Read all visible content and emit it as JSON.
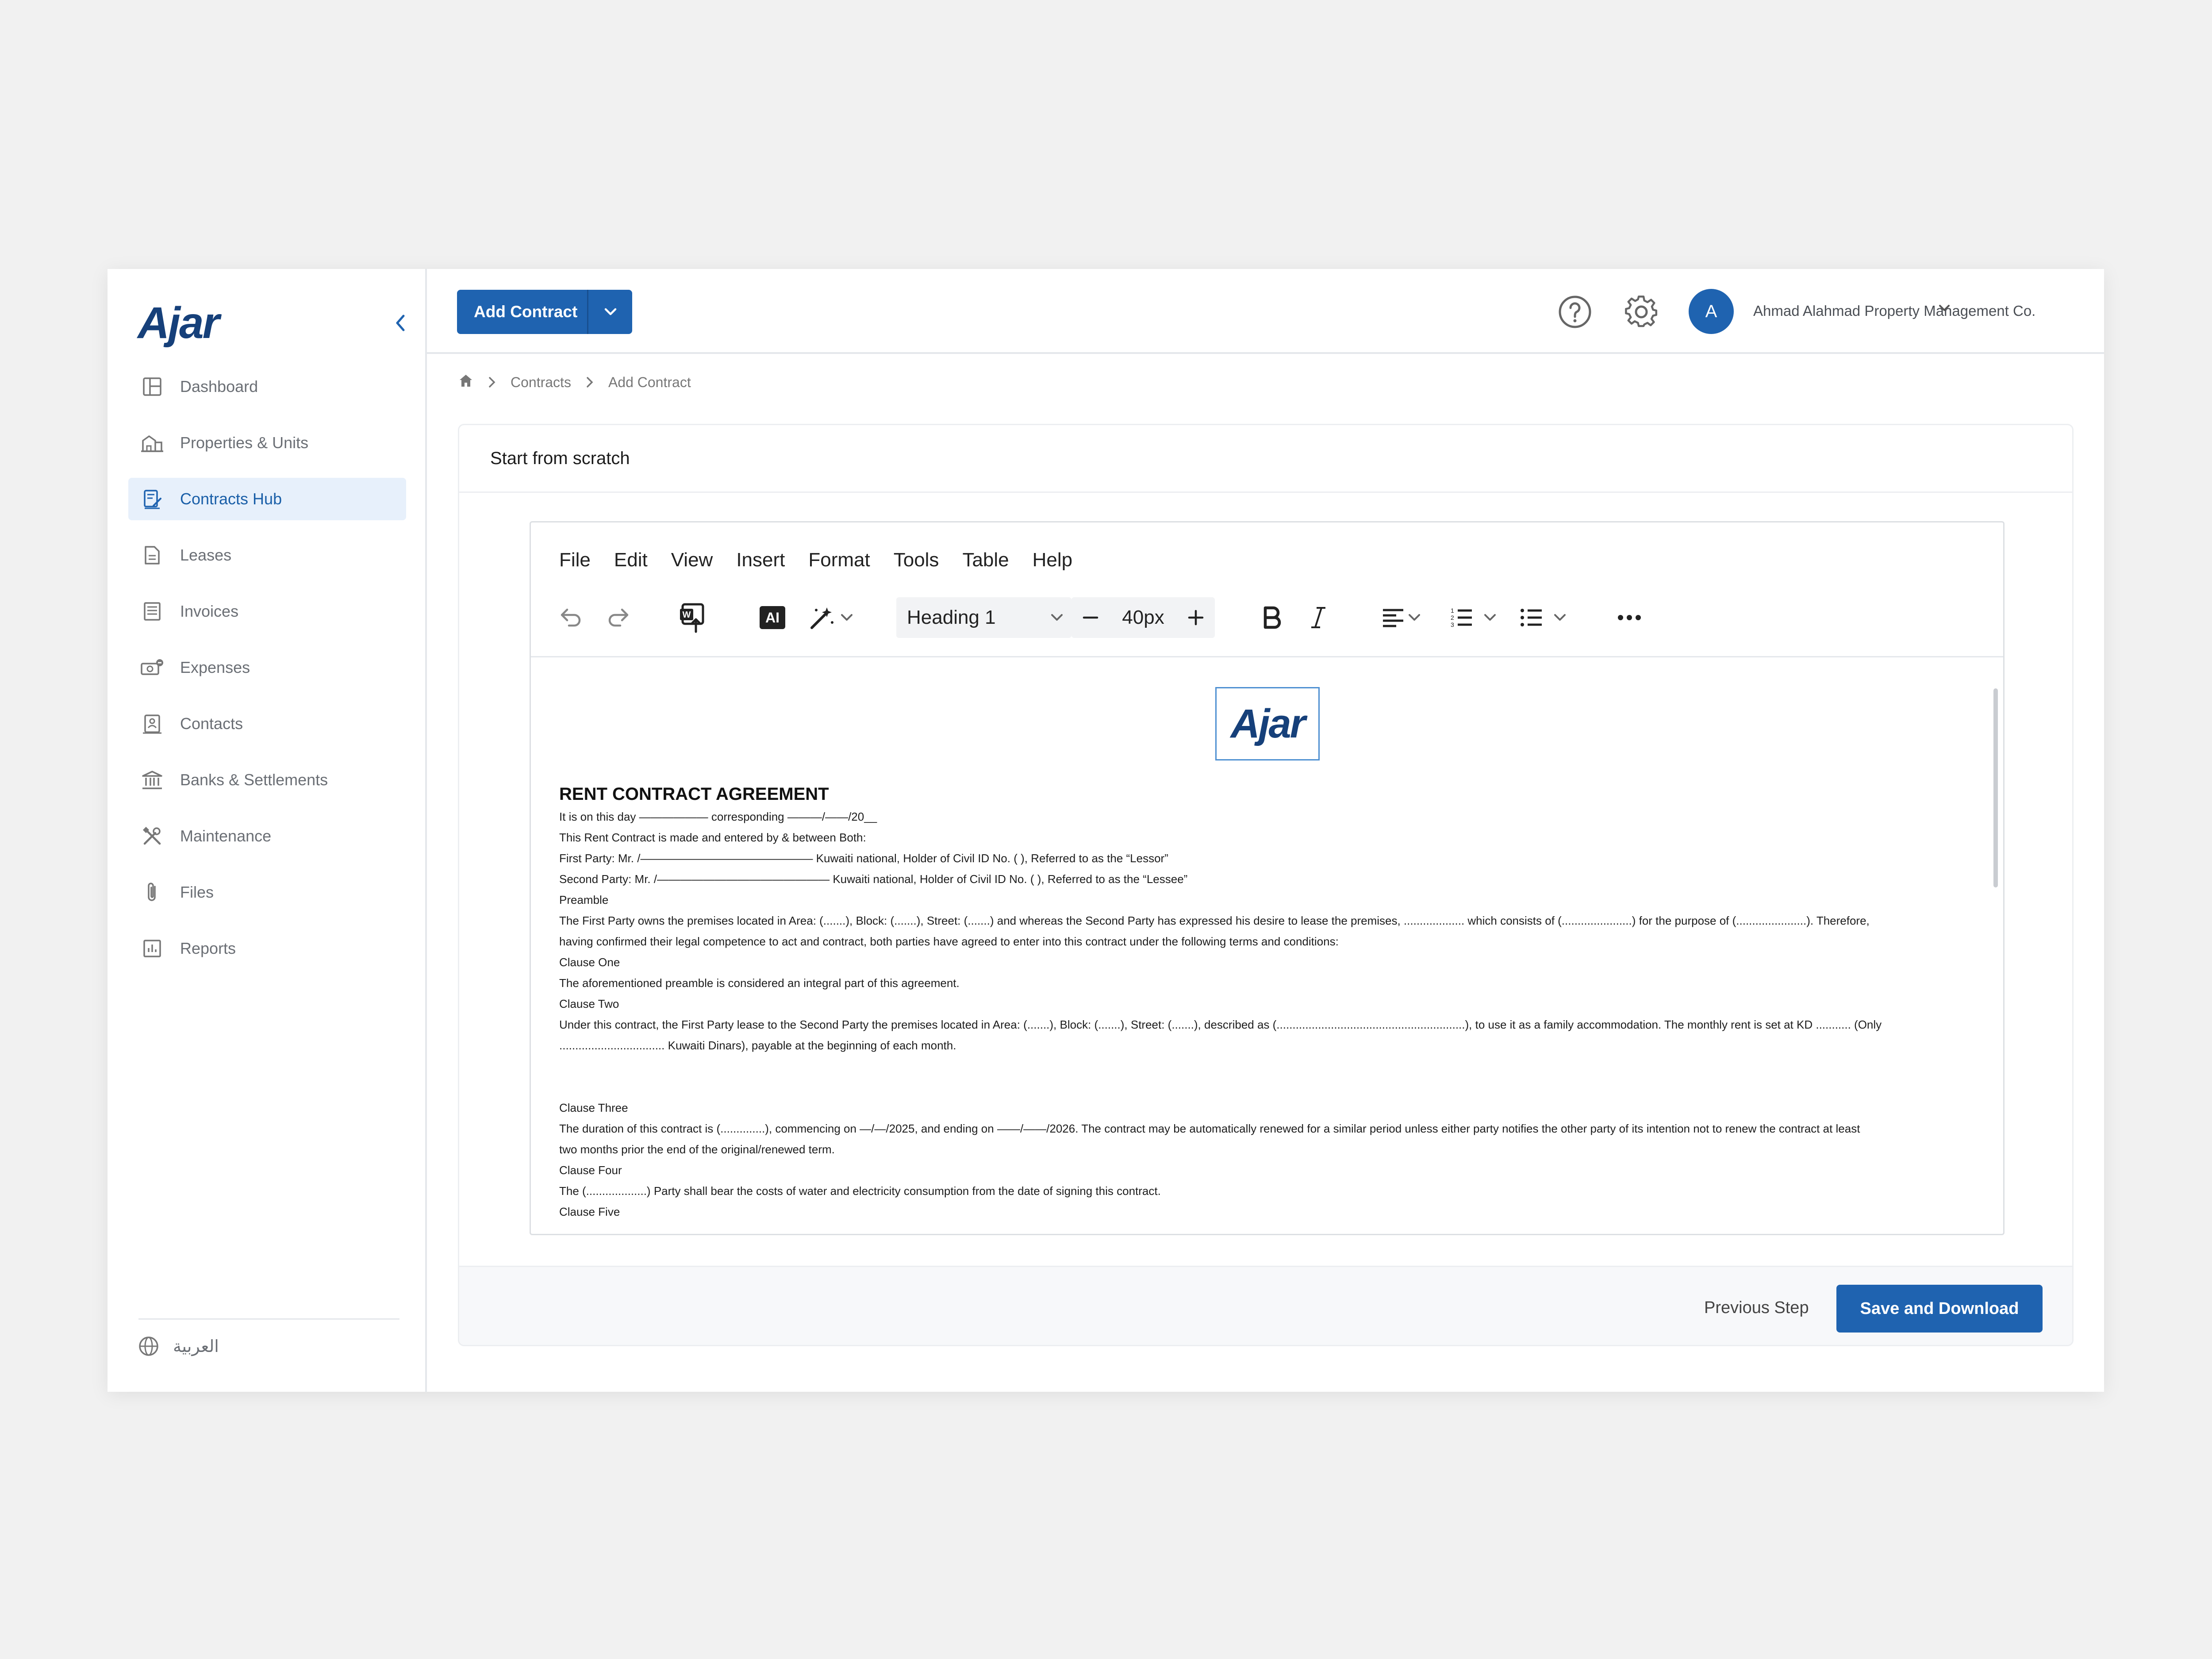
{
  "app": {
    "logo": "Ajar"
  },
  "sidebar": {
    "items": [
      {
        "label": "Dashboard",
        "icon": "layout-icon"
      },
      {
        "label": "Properties & Units",
        "icon": "building-icon"
      },
      {
        "label": "Contracts Hub",
        "icon": "contract-icon",
        "active": true
      },
      {
        "label": "Leases",
        "icon": "document-icon"
      },
      {
        "label": "Invoices",
        "icon": "invoice-icon"
      },
      {
        "label": "Expenses",
        "icon": "money-icon"
      },
      {
        "label": "Contacts",
        "icon": "contact-icon"
      },
      {
        "label": "Banks & Settlements",
        "icon": "bank-icon"
      },
      {
        "label": "Maintenance",
        "icon": "tools-icon"
      },
      {
        "label": "Files",
        "icon": "paperclip-icon"
      },
      {
        "label": "Reports",
        "icon": "chart-icon"
      }
    ],
    "language": "العربية"
  },
  "header": {
    "add_contract": "Add Contract",
    "avatar_initial": "A",
    "company": "Ahmad Alahmad Property Management Co."
  },
  "breadcrumb": {
    "level1": "Contracts",
    "level2": "Add Contract"
  },
  "card": {
    "title": "Start from scratch"
  },
  "editor": {
    "menus": [
      "File",
      "Edit",
      "View",
      "Insert",
      "Format",
      "Tools",
      "Table",
      "Help"
    ],
    "block_style": "Heading 1",
    "font_size": "40px",
    "ai_label": "AI"
  },
  "document": {
    "logo": "Ajar",
    "title": "RENT CONTRACT AGREEMENT",
    "lines": [
      "It is on this day —————— corresponding ———/——/20__",
      "This Rent Contract is made and entered by & between Both:",
      "First Party: Mr. /——————————————— Kuwaiti national, Holder of Civil ID No. ( ), Referred to as the “Lessor”",
      "Second Party: Mr. /——————————————— Kuwaiti national, Holder of Civil ID No. ( ), Referred to as the “Lessee”",
      "Preamble",
      "The First Party owns the premises located in Area: (.......), Block: (.......), Street: (.......) and whereas the Second Party has expressed his desire to lease the premises, ................... which consists of (......................) for the purpose of (......................). Therefore,",
      "having confirmed their legal competence to act and contract, both parties have agreed to enter into this contract under the following terms and conditions:",
      "Clause One",
      "The aforementioned preamble is considered an integral part of this agreement.",
      "Clause Two",
      "Under this contract, the First Party lease to the Second Party the premises located in Area: (.......), Block: (.......), Street: (.......), described as (...........................................................), to use it as a family accommodation. The monthly rent is set at KD ........... (Only",
      "................................. Kuwaiti Dinars), payable at the beginning of each month."
    ],
    "lines2": [
      "Clause Three",
      "The duration of this contract is (..............), commencing on —/—/2025, and ending on ——/——/2026. The contract may be automatically renewed for a similar period unless either party notifies the other party of its intention not to renew the contract at least",
      "two months prior the end of the original/renewed term.",
      "Clause Four",
      "The (...................) Party shall bear the costs of water and electricity consumption from the date of signing this contract.",
      "Clause Five"
    ]
  },
  "footer": {
    "previous": "Previous Step",
    "save": "Save and Download"
  },
  "colors": {
    "primary": "#1f63b0",
    "logo": "#16407a",
    "active_bg": "#e7f0fb"
  }
}
